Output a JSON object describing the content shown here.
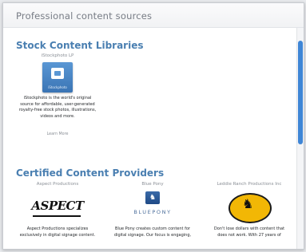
{
  "window": {
    "title": "Professional content sources"
  },
  "sections": {
    "stock": {
      "heading": "Stock Content Libraries",
      "provider": {
        "name": "iStockphoto LP",
        "logo_text": "iStockphoto",
        "description": "iStockphoto is the world's original\nsource for affordable, user-generated\nroyalty-free stock photos, illustrations,\nvideos and more.",
        "learn_more": "Learn More"
      }
    },
    "certified": {
      "heading": "Certified Content Providers",
      "providers": [
        {
          "name": "Aspect Productions",
          "logo_text": "ASPECT",
          "description": "Aspect Productions specializes\nexclusively in digital signage content."
        },
        {
          "name": "Blue Pony",
          "logo_text": "BLUEPONY",
          "description": "Blue Pony creates custom content for\ndigital signage. Our focus is engaging,"
        },
        {
          "name": "Leddie Ranch Productions Inc",
          "description": "Don't lose dollars with content that\ndoes not work. With 27 years of"
        }
      ]
    }
  },
  "colors": {
    "heading": "#4a7fb1",
    "scroll_thumb": "#3f86d6",
    "stock_logo": "#4a86c6"
  }
}
